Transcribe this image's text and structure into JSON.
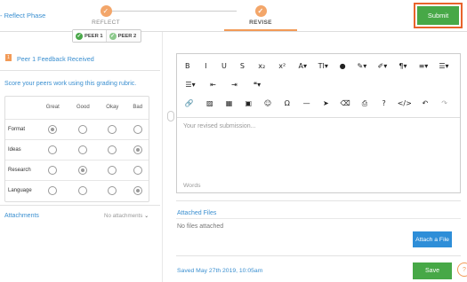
{
  "header": {
    "back_link": "- Reflect Phase",
    "steps": [
      {
        "label": "REFLECT"
      },
      {
        "label": "REVISE"
      }
    ],
    "submit_label": "Submit",
    "accent_color": "#f29a57",
    "submit_highlight_color": "#e8632c"
  },
  "peer_tabs": [
    {
      "label": "PEER 1"
    },
    {
      "label": "PEER 2"
    }
  ],
  "feedback": {
    "badge": "1",
    "title": "Peer 1 Feedback Received",
    "rubric_hint": "Score your peers work using this grading rubric.",
    "columns": [
      "Great",
      "Good",
      "Okay",
      "Bad"
    ],
    "rows": [
      {
        "label": "Format",
        "selected": "Great"
      },
      {
        "label": "Ideas",
        "selected": "Bad"
      },
      {
        "label": "Research",
        "selected": "Good"
      },
      {
        "label": "Language",
        "selected": "Bad"
      }
    ],
    "attachments_label": "Attachments",
    "no_attachments": "No attachments"
  },
  "editor": {
    "toolbar_row1": [
      {
        "icon": "bold-icon",
        "glyph": "B"
      },
      {
        "icon": "italic-icon",
        "glyph": "I"
      },
      {
        "icon": "underline-icon",
        "glyph": "U"
      },
      {
        "icon": "strikethrough-icon",
        "glyph": "S"
      },
      {
        "icon": "subscript-icon",
        "glyph": "x₂"
      },
      {
        "icon": "superscript-icon",
        "glyph": "x²"
      },
      {
        "icon": "font-family-icon",
        "glyph": "A▾"
      },
      {
        "icon": "font-size-icon",
        "glyph": "TI▾"
      },
      {
        "icon": "text-color-icon",
        "glyph": "●"
      },
      {
        "icon": "highlight-icon",
        "glyph": "✎▾"
      },
      {
        "icon": "clear-format-icon",
        "glyph": "✐▾"
      },
      {
        "icon": "paragraph-icon",
        "glyph": "¶▾"
      },
      {
        "icon": "align-icon",
        "glyph": "≡▾"
      },
      {
        "icon": "ordered-list-icon",
        "glyph": "☰▾"
      }
    ],
    "toolbar_row2": [
      {
        "icon": "unordered-list-icon",
        "glyph": "☰▾"
      },
      {
        "icon": "outdent-icon",
        "glyph": "⇤"
      },
      {
        "icon": "indent-icon",
        "glyph": "⇥"
      },
      {
        "icon": "quote-icon",
        "glyph": "❝▾"
      }
    ],
    "toolbar_row3": [
      {
        "icon": "link-icon",
        "glyph": "🔗"
      },
      {
        "icon": "image-icon",
        "glyph": "▨"
      },
      {
        "icon": "table-icon",
        "glyph": "▦"
      },
      {
        "icon": "video-icon",
        "glyph": "▣"
      },
      {
        "icon": "emoji-icon",
        "glyph": "☺"
      },
      {
        "icon": "special-char-icon",
        "glyph": "Ω"
      },
      {
        "icon": "horizontal-line-icon",
        "glyph": "—"
      },
      {
        "icon": "select-all-icon",
        "glyph": "➤"
      },
      {
        "icon": "eraser-icon",
        "glyph": "⌫"
      },
      {
        "icon": "print-icon",
        "glyph": "⎙"
      },
      {
        "icon": "help-icon",
        "glyph": "?"
      },
      {
        "icon": "code-view-icon",
        "glyph": "</>"
      },
      {
        "icon": "undo-icon",
        "glyph": "↶"
      },
      {
        "icon": "redo-icon",
        "glyph": "↷"
      }
    ],
    "placeholder": "Your revised submission...",
    "words_label": "Words"
  },
  "files": {
    "title": "Attached Files",
    "empty_text": "No files attached",
    "attach_label": "Attach a File"
  },
  "footer": {
    "saved_text": "Saved May 27th 2019, 10:05am",
    "save_label": "Save",
    "help_glyph": "?"
  }
}
